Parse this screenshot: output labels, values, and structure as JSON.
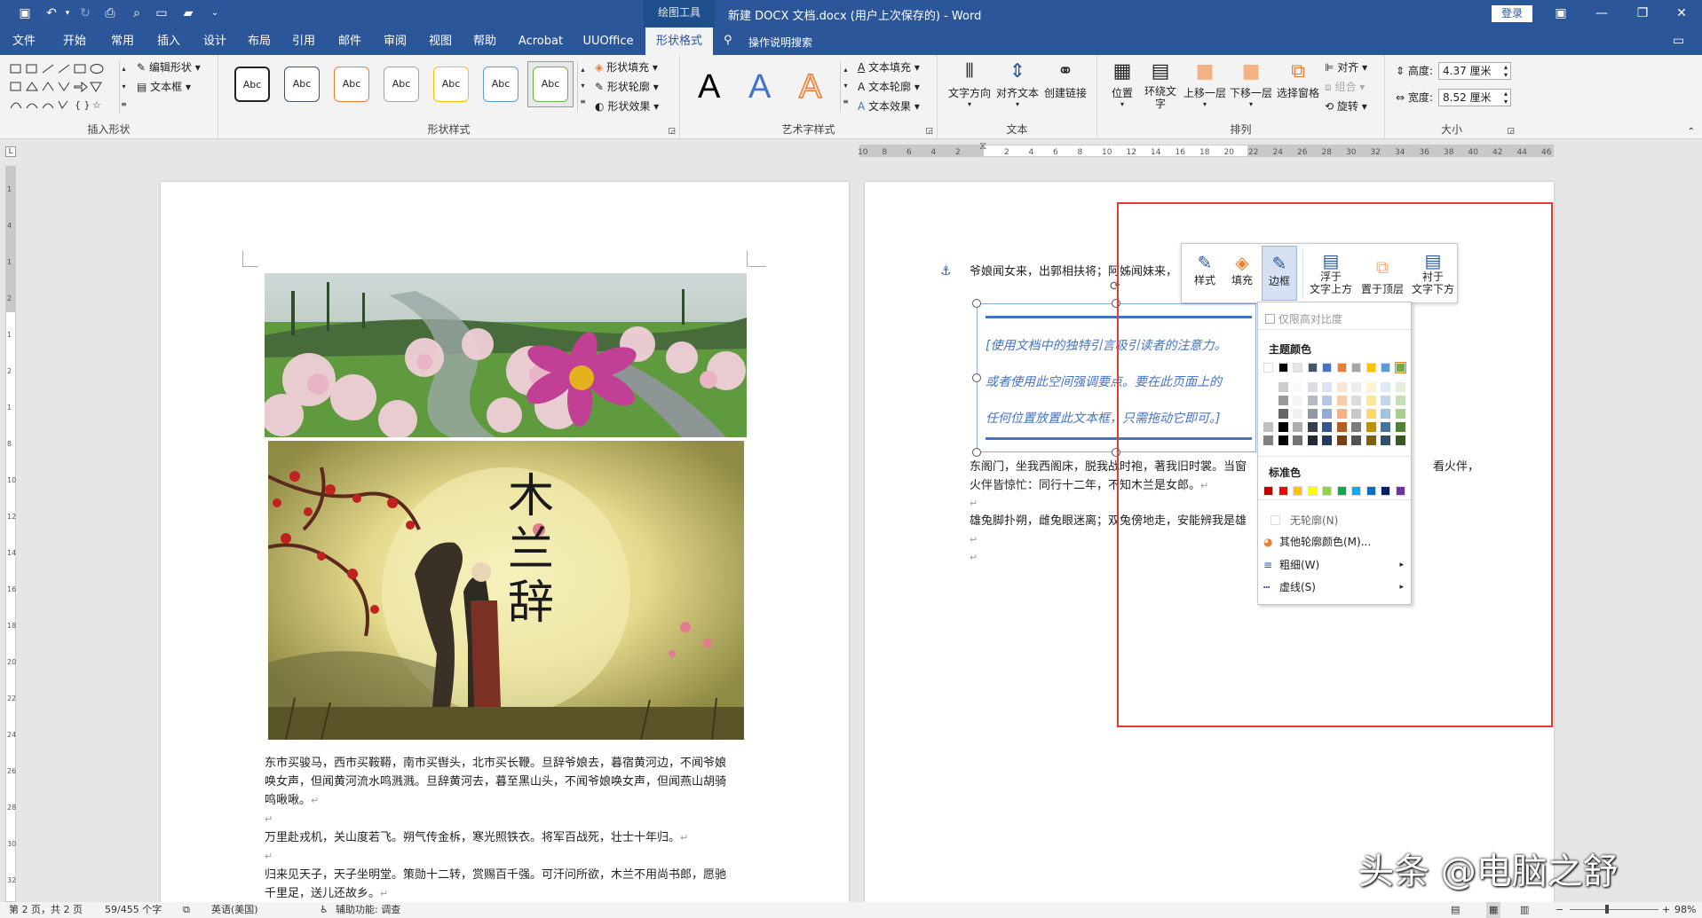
{
  "titlebar": {
    "context_tools": "绘图工具",
    "title": "新建 DOCX 文档.docx (用户上次保存的) - Word",
    "login": "登录"
  },
  "tabs": [
    "文件",
    "开始",
    "常用",
    "插入",
    "设计",
    "布局",
    "引用",
    "邮件",
    "审阅",
    "视图",
    "帮助",
    "Acrobat",
    "UUOffice",
    "形状格式"
  ],
  "active_tab": "形状格式",
  "tell_me": "操作说明搜索",
  "ribbon": {
    "insert_shapes": {
      "label": "插入形状",
      "edit_shape": "编辑形状",
      "text_box": "文本框"
    },
    "shape_styles": {
      "label": "形状样式",
      "sample": "Abc",
      "fill": "形状填充",
      "outline": "形状轮廓",
      "effects": "形状效果"
    },
    "wordart": {
      "label": "艺术字样式",
      "letter": "A",
      "text_fill": "文本填充",
      "text_outline": "文本轮廓",
      "text_effects": "文本效果"
    },
    "text": {
      "label": "文本",
      "direction": "文字方向",
      "align": "对齐文本",
      "link": "创建链接"
    },
    "arrange": {
      "label": "排列",
      "position": "位置",
      "wrap": "环绕文字",
      "forward": "上移一层",
      "backward": "下移一层",
      "pane": "选择窗格",
      "align": "对齐",
      "group": "组合",
      "rotate": "旋转"
    },
    "size": {
      "label": "大小",
      "height_label": "高度:",
      "height": "4.37 厘米",
      "width_label": "宽度:",
      "width": "8.52 厘米"
    }
  },
  "ruler_numbers": [
    "10",
    "8",
    "6",
    "4",
    "2",
    "",
    "2",
    "4",
    "6",
    "8",
    "10",
    "12",
    "14",
    "16",
    "18",
    "20",
    "22",
    "24",
    "26",
    "28",
    "30",
    "32",
    "34",
    "36",
    "38",
    "40",
    "42",
    "44",
    "46"
  ],
  "vruler_numbers": [
    "1",
    "4",
    "1",
    "2",
    "1",
    "2",
    "1",
    "8",
    "10",
    "12",
    "14",
    "16",
    "18",
    "20",
    "22",
    "24",
    "26",
    "28",
    "30",
    "32"
  ],
  "left_page": {
    "paragraphs": [
      [
        "东市买骏马，西市买鞍鞯，南市买辔头，北市买长鞭。旦辞爷娘去，暮宿黄河边，不闻爷娘",
        "唤女声，但闻黄河流水鸣溅溅。旦辞黄河去，暮至黑山头，不闻爷娘唤女声，但闻燕山胡骑",
        "鸣啾啾。"
      ],
      [
        "万里赴戎机，关山度若飞。朔气传金柝，寒光照铁衣。将军百战死，壮士十年归。"
      ],
      [
        "归来见天子，天子坐明堂。策勋十二转，赏赐百千强。可汗问所欲，木兰不用尚书郎，愿驰",
        "千里足，送儿还故乡。"
      ]
    ],
    "image2_title": "木兰辞"
  },
  "right_page": {
    "line1": "爷娘闻女来，出郭相扶将；阿姊闻妹来，",
    "textbox_lines": [
      "[使用文档中的独特引言吸引读者的注意力。",
      "或者使用此空间强调要点。要在此页面上的",
      "任何位置放置此文本框，只需拖动它即可。]"
    ],
    "line2": "东阁门，坐我西阁床，脱我战时袍，著我旧时裳。当窗",
    "line2_tail": "看火伴，",
    "line3": "火伴皆惊忙：同行十二年，不知木兰是女郎。",
    "line4": "雄兔脚扑朔，雌兔眼迷离；双兔傍地走，安能辨我是雄"
  },
  "mini_toolbar": {
    "style": "样式",
    "fill": "填充",
    "border": "边框",
    "float_above_1": "浮于",
    "float_above_2": "文字上方",
    "bring_front": "置于顶层",
    "below_1": "衬于",
    "below_2": "文字下方"
  },
  "outline_menu": {
    "high_contrast": "仅限高对比度",
    "theme_colors": "主题颜色",
    "standard_colors": "标准色",
    "no_outline": "无轮廓(N)",
    "more_colors": "其他轮廓颜色(M)...",
    "weight": "粗细(W)",
    "dashes": "虚线(S)",
    "theme_top": [
      "#ffffff",
      "#000000",
      "#e7e6e6",
      "#44546a",
      "#4472c4",
      "#ed7d31",
      "#a5a5a5",
      "#ffc000",
      "#5b9bd5",
      "#70ad47"
    ],
    "standard": [
      "#c00000",
      "#ff0000",
      "#ffc000",
      "#ffff00",
      "#92d050",
      "#00b050",
      "#00b0f0",
      "#0070c0",
      "#002060",
      "#7030a0"
    ]
  },
  "status": {
    "page": "第 2 页，共 2 页",
    "words": "59/455 个字",
    "language": "英语(美国)",
    "accessibility": "辅助功能: 调查",
    "zoom": "98%"
  },
  "watermark": "头条 @电脑之舒"
}
